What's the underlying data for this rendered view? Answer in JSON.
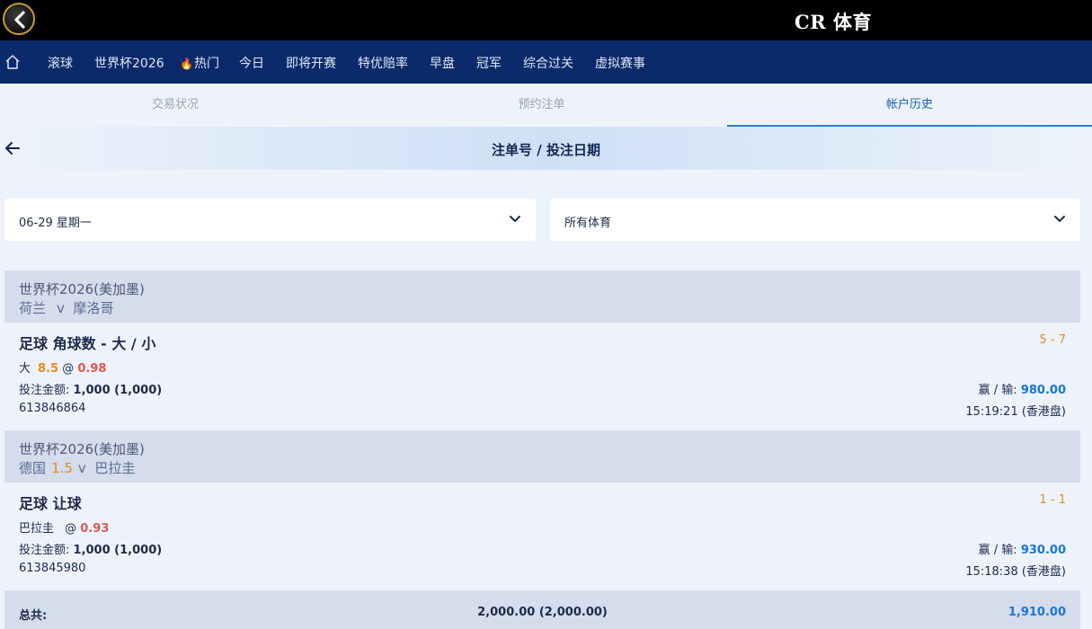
{
  "header": {
    "title": "CR 体育",
    "back_icon": "chevron-left-icon"
  },
  "nav": {
    "home_icon": "home-icon",
    "items": [
      "滚球",
      "世界杯2026",
      "热门",
      "今日",
      "即将开赛",
      "特优赔率",
      "早盘",
      "冠军",
      "综合过关",
      "虚拟赛事"
    ]
  },
  "tabs": [
    "交易状况",
    "预约注单",
    "帐户历史"
  ],
  "active_tab": "帐户历史",
  "subheader": {
    "title": "注单号 / 投注日期"
  },
  "filters": {
    "date": "06-29 星期一",
    "sport": "所有体育"
  },
  "bets": [
    {
      "league": "世界杯2026(美加墨)",
      "home": "荷兰",
      "handicap": "",
      "vs": "v",
      "away": "摩洛哥",
      "market": "足球 角球数 - 大 / 小",
      "score": "5 - 7",
      "selection": "大",
      "line": "8.5",
      "at": "@",
      "odds": "0.98",
      "stake_label": "投注金额:",
      "stake": "1,000 (1,000)",
      "winlose_label": "赢 / 输:",
      "winlose": "980.00",
      "ticket": "613846864",
      "time": "15:19:21 (香港盘)"
    },
    {
      "league": "世界杯2026(美加墨)",
      "home": "德国",
      "handicap": "1.5",
      "vs": "v",
      "away": "巴拉圭",
      "market": "足球 让球",
      "score": "1 - 1",
      "selection": "巴拉圭",
      "line": "",
      "at": "@",
      "odds": "0.93",
      "stake_label": "投注金额:",
      "stake": "1,000 (1,000)",
      "winlose_label": "赢 / 输:",
      "winlose": "930.00",
      "ticket": "613845980",
      "time": "15:18:38 (香港盘)"
    }
  ],
  "total": {
    "label": "总共:",
    "stake": "2,000.00 (2,000.00)",
    "winlose": "1,910.00"
  },
  "colors": {
    "nav_bg": "#0b2a6b",
    "accent_blue": "#1a76d2",
    "odds_red": "#e05555",
    "line_orange": "#e88a1a"
  }
}
